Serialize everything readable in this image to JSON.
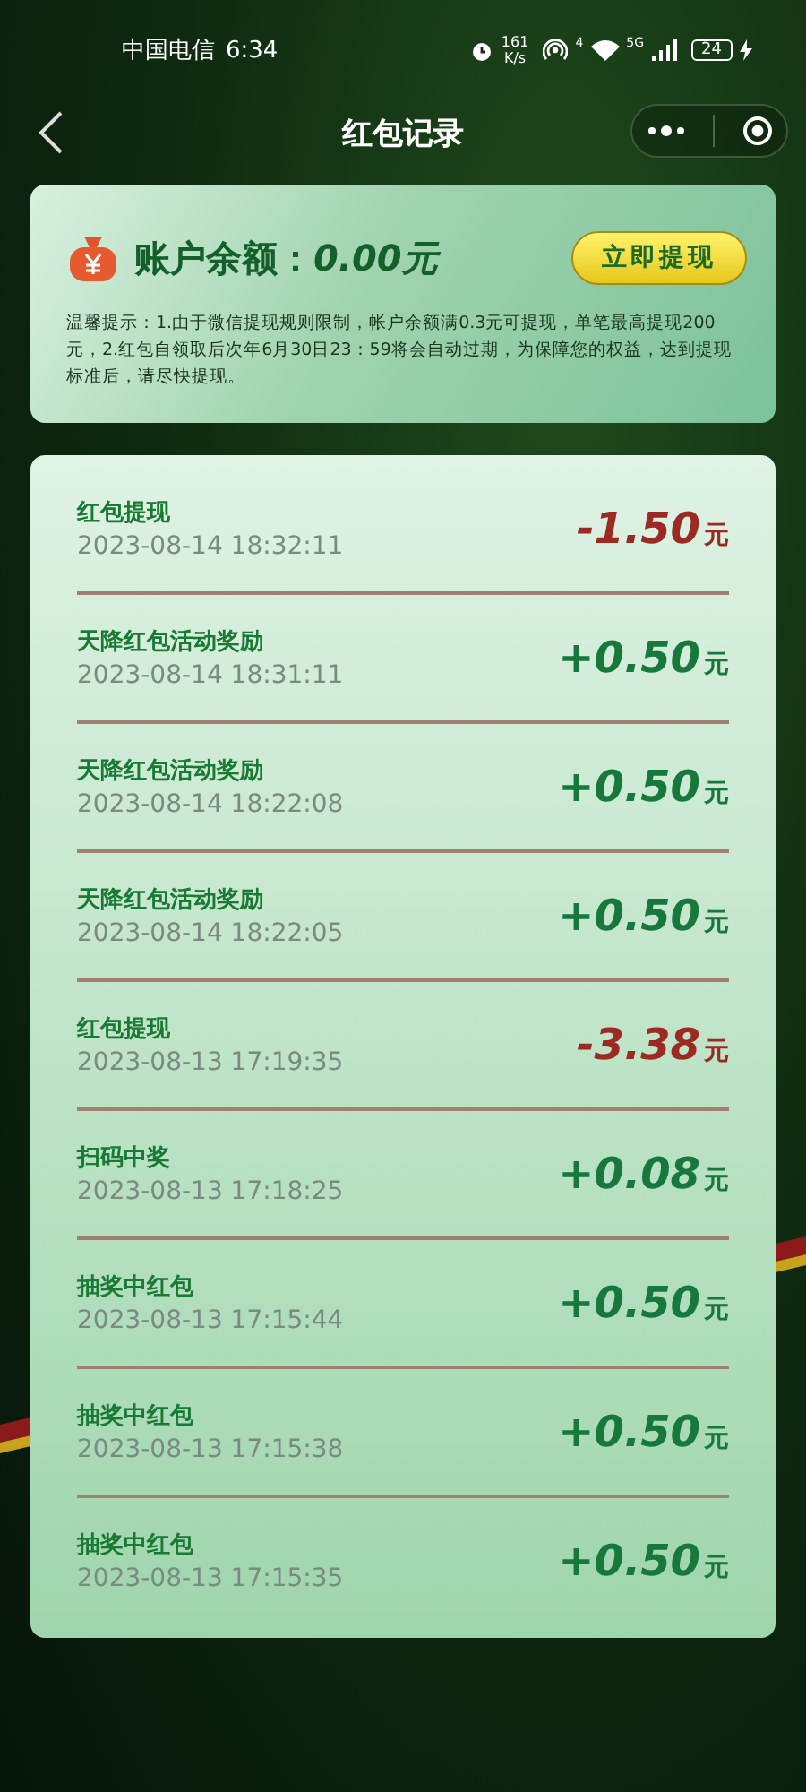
{
  "status_bar": {
    "carrier": "中国电信",
    "time": "6:34",
    "speed_value": "161",
    "speed_unit": "K/s",
    "hotspot_label": "4",
    "network_label": "5G",
    "battery": "24"
  },
  "nav": {
    "title": "红包记录"
  },
  "balance": {
    "label": "账户余额：",
    "amount": "0.00元",
    "button": "立即提现",
    "notice": "温馨提示：1.由于微信提现规则限制，帐户余额满0.3元可提现，单笔最高提现200元，2.红包自领取后次年6月30日23：59将会自动过期，为保障您的权益，达到提现标准后，请尽快提现。"
  },
  "records": [
    {
      "title": "红包提现",
      "time": "2023-08-14 18:32:11",
      "amount": "-1.50",
      "unit": "元",
      "kind": "debit"
    },
    {
      "title": "天降红包活动奖励",
      "time": "2023-08-14 18:31:11",
      "amount": "+0.50",
      "unit": "元",
      "kind": "credit"
    },
    {
      "title": "天降红包活动奖励",
      "time": "2023-08-14 18:22:08",
      "amount": "+0.50",
      "unit": "元",
      "kind": "credit"
    },
    {
      "title": "天降红包活动奖励",
      "time": "2023-08-14 18:22:05",
      "amount": "+0.50",
      "unit": "元",
      "kind": "credit"
    },
    {
      "title": "红包提现",
      "time": "2023-08-13 17:19:35",
      "amount": "-3.38",
      "unit": "元",
      "kind": "debit"
    },
    {
      "title": "扫码中奖",
      "time": "2023-08-13 17:18:25",
      "amount": "+0.08",
      "unit": "元",
      "kind": "credit"
    },
    {
      "title": "抽奖中红包",
      "time": "2023-08-13 17:15:44",
      "amount": "+0.50",
      "unit": "元",
      "kind": "credit"
    },
    {
      "title": "抽奖中红包",
      "time": "2023-08-13 17:15:38",
      "amount": "+0.50",
      "unit": "元",
      "kind": "credit"
    },
    {
      "title": "抽奖中红包",
      "time": "2023-08-13 17:15:35",
      "amount": "+0.50",
      "unit": "元",
      "kind": "credit"
    }
  ]
}
